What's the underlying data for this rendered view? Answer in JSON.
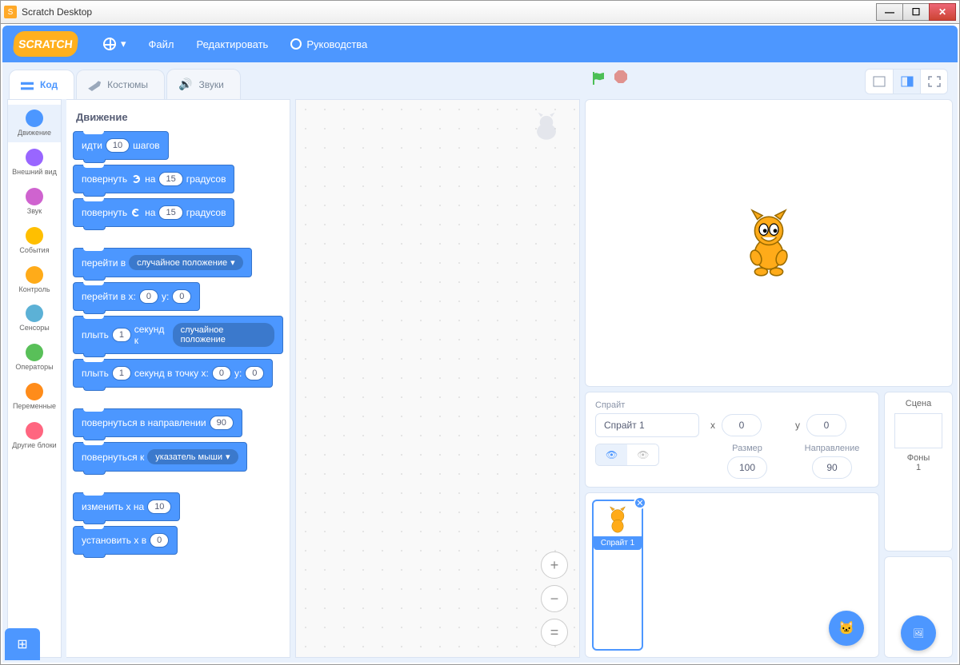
{
  "window": {
    "title": "Scratch Desktop"
  },
  "menubar": {
    "logo": "SCRATCH",
    "file": "Файл",
    "edit": "Редактировать",
    "tutorials": "Руководства"
  },
  "tabs": {
    "code": "Код",
    "costumes": "Костюмы",
    "sounds": "Звуки"
  },
  "categories": [
    {
      "label": "Движение",
      "color": "#4c97ff",
      "active": true
    },
    {
      "label": "Внешний вид",
      "color": "#9966ff"
    },
    {
      "label": "Звук",
      "color": "#cf63cf"
    },
    {
      "label": "События",
      "color": "#ffbf00"
    },
    {
      "label": "Контроль",
      "color": "#ffab19"
    },
    {
      "label": "Сенсоры",
      "color": "#5cb1d6"
    },
    {
      "label": "Операторы",
      "color": "#59c059"
    },
    {
      "label": "Переменные",
      "color": "#ff8c1a"
    },
    {
      "label": "Другие блоки",
      "color": "#ff6680"
    }
  ],
  "palette": {
    "title": "Движение",
    "blocks": {
      "b0": {
        "t1": "идти",
        "v1": "10",
        "t2": "шагов"
      },
      "b1": {
        "t1": "повернуть",
        "dir": "cw",
        "t2": "на",
        "v1": "15",
        "t3": "градусов"
      },
      "b2": {
        "t1": "повернуть",
        "dir": "ccw",
        "t2": "на",
        "v1": "15",
        "t3": "градусов"
      },
      "b3": {
        "t1": "перейти в",
        "dd": "случайное положение"
      },
      "b4": {
        "t1": "перейти в x:",
        "v1": "0",
        "t2": "y:",
        "v2": "0"
      },
      "b5": {
        "t1": "плыть",
        "v1": "1",
        "t2": "секунд к",
        "dd": "случайное положение"
      },
      "b6": {
        "t1": "плыть",
        "v1": "1",
        "t2": "секунд в точку x:",
        "v2": "0",
        "t3": "y:",
        "v3": "0"
      },
      "b7": {
        "t1": "повернуться в направлении",
        "v1": "90"
      },
      "b8": {
        "t1": "повернуться к",
        "dd": "указатель мыши"
      },
      "b9": {
        "t1": "изменить x на",
        "v1": "10"
      },
      "b10": {
        "t1": "установить x в",
        "v1": "0"
      }
    }
  },
  "sprite": {
    "label": "Спрайт",
    "name": "Спрайт 1",
    "x_lbl": "x",
    "x": "0",
    "y_lbl": "y",
    "y": "0",
    "size_lbl": "Размер",
    "size": "100",
    "dir_lbl": "Направление",
    "dir": "90"
  },
  "scene": {
    "title": "Сцена",
    "backdrops_lbl": "Фоны",
    "backdrops": "1"
  },
  "spritecard": {
    "name": "Спрайт 1"
  }
}
